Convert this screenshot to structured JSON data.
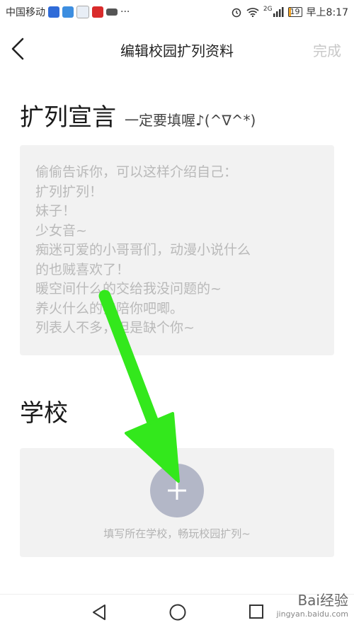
{
  "status_bar": {
    "carrier": "中国移动",
    "more": "···",
    "network": "2G",
    "battery_level": "19",
    "time": "早上8:17",
    "battery_color": "#f2a324"
  },
  "nav": {
    "back_icon": "chevron-left-icon",
    "title": "编辑校园扩列资料",
    "done_label": "完成"
  },
  "intro_section": {
    "title": "扩列宣言",
    "hint": "一定要填喔♪(^∇^*)",
    "placeholder_lines": [
      "偷偷告诉你，可以这样介绍自己：",
      "扩列扩列！",
      "妹子！",
      "少女音~",
      "痴迷可爱的小哥哥们，动漫小说什么",
      "的也贼喜欢了！",
      "暖空间什么的交给我没问题的~",
      "养火什么的我陪你吧唧。",
      "列表人不多，但是缺个你~"
    ]
  },
  "school_section": {
    "title": "学校",
    "add_icon": "plus-icon",
    "hint": "填写所在学校，畅玩校园扩列~"
  },
  "watermark": {
    "brand": "Bai经验",
    "site": "jingyan.baidu.com"
  },
  "annotation": {
    "arrow_color": "#33e81c"
  }
}
